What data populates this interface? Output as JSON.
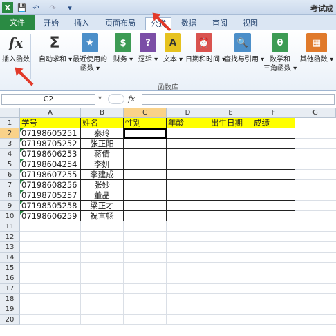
{
  "window": {
    "title": "考试成"
  },
  "quick_access": {
    "save_icon": "save-icon",
    "undo_icon": "undo-icon",
    "redo_icon": "redo-icon",
    "excel_icon": "excel-logo-icon"
  },
  "tabs": [
    "文件",
    "开始",
    "插入",
    "页面布局",
    "公式",
    "数据",
    "审阅",
    "视图"
  ],
  "active_tab": "公式",
  "ribbon": {
    "buttons": [
      {
        "label": "插入函数",
        "icon": "fx-icon"
      },
      {
        "label": "自动求和",
        "icon": "sigma-icon"
      },
      {
        "label": "最近使用的",
        "label2": "函数",
        "icon": "recent-book-icon"
      },
      {
        "label": "财务",
        "icon": "finance-book-icon"
      },
      {
        "label": "逻辑",
        "icon": "logic-book-icon"
      },
      {
        "label": "文本",
        "icon": "text-book-icon"
      },
      {
        "label": "日期和时间",
        "icon": "date-book-icon"
      },
      {
        "label": "查找与引用",
        "icon": "lookup-book-icon"
      },
      {
        "label": "数学和",
        "label2": "三角函数",
        "icon": "math-book-icon"
      },
      {
        "label": "其他函数",
        "icon": "more-books-icon"
      }
    ],
    "group_label": "函数库"
  },
  "formula_bar": {
    "name_box": "C2",
    "fx_label": "fx",
    "formula": ""
  },
  "columns": [
    "A",
    "B",
    "C",
    "D",
    "E",
    "F",
    "G"
  ],
  "selected_column": "C",
  "selected_row": "2",
  "rows": [
    "1",
    "2",
    "3",
    "4",
    "5",
    "6",
    "7",
    "8",
    "9",
    "10",
    "11",
    "12",
    "13",
    "14",
    "15",
    "16",
    "17",
    "18",
    "19",
    "20"
  ],
  "sheet": {
    "headers": [
      "学号",
      "姓名",
      "性别",
      "年龄",
      "出生日期",
      "成绩"
    ],
    "records": [
      {
        "id": "07198605251",
        "name": "秦玲"
      },
      {
        "id": "07198705252",
        "name": "张正阳"
      },
      {
        "id": "07198606253",
        "name": "蒋倩"
      },
      {
        "id": "07198604254",
        "name": "李妍"
      },
      {
        "id": "07198607255",
        "name": "李建成"
      },
      {
        "id": "07198608256",
        "name": "张妙"
      },
      {
        "id": "07198705257",
        "name": "董晶"
      },
      {
        "id": "07198505258",
        "name": "梁正才"
      },
      {
        "id": "07198606259",
        "name": "祝言畅"
      }
    ]
  },
  "colors": {
    "header_fill": "#ffff00",
    "file_tab": "#2a8a43",
    "selection_header": "#f9d28a",
    "annotation_arrow": "#e23a2a"
  }
}
